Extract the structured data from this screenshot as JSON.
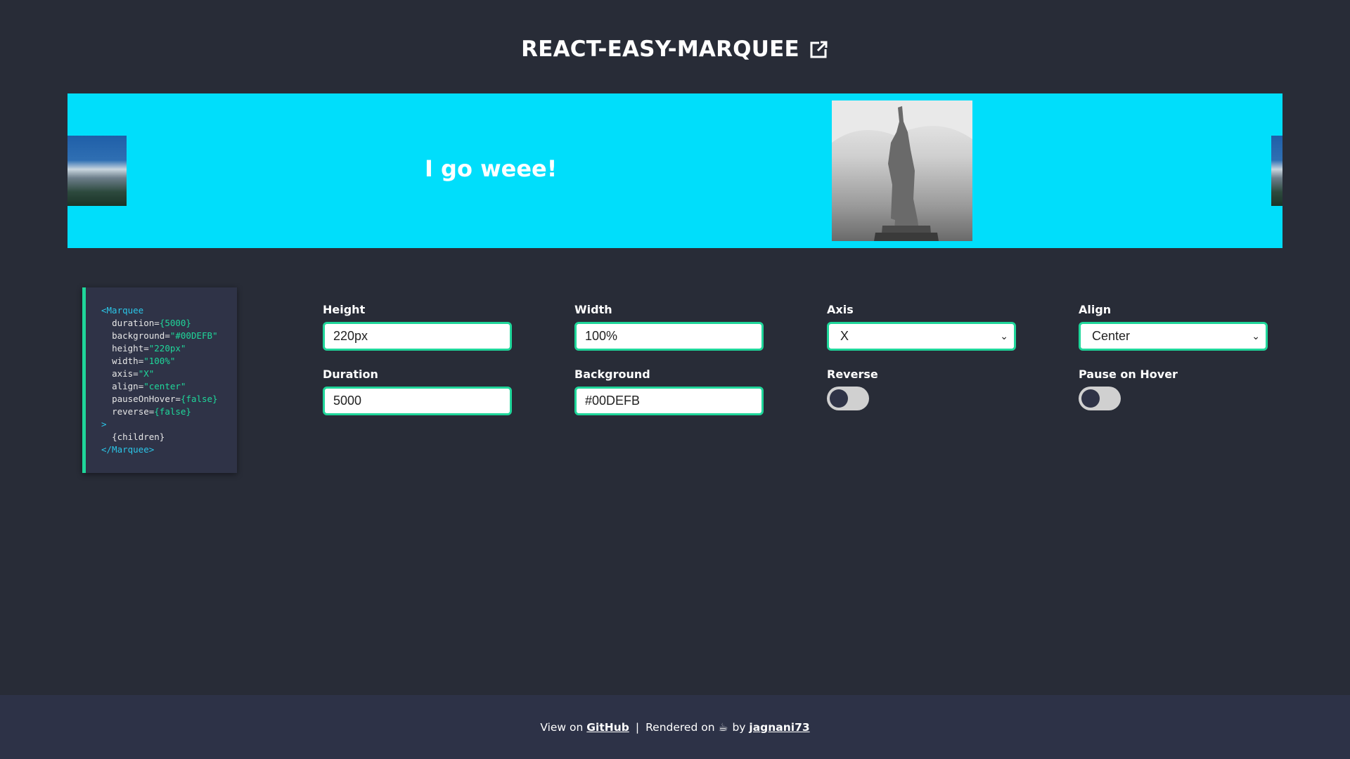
{
  "header": {
    "title": "REACT-EASY-MARQUEE",
    "link_icon": "external-link-icon"
  },
  "marquee": {
    "background": "#00DEFB",
    "text": "I go weee!",
    "items": [
      "mountain-image",
      "text",
      "statue-of-liberty-image",
      "mountain-image"
    ]
  },
  "code": {
    "open_tag": "<Marquee",
    "props": [
      {
        "name": "duration=",
        "value": "{5000}"
      },
      {
        "name": "background=",
        "value": "\"#00DEFB\""
      },
      {
        "name": "height=",
        "value": "\"220px\""
      },
      {
        "name": "width=",
        "value": "\"100%\""
      },
      {
        "name": "axis=",
        "value": "\"X\""
      },
      {
        "name": "align=",
        "value": "\"center\""
      },
      {
        "name": "pauseOnHover=",
        "value": "{false}"
      },
      {
        "name": "reverse=",
        "value": "{false}"
      }
    ],
    "close_bracket": ">",
    "children": "{children}",
    "close_tag": "</Marquee>"
  },
  "controls": {
    "height": {
      "label": "Height",
      "value": "220px"
    },
    "width": {
      "label": "Width",
      "value": "100%"
    },
    "axis": {
      "label": "Axis",
      "value": "X"
    },
    "align": {
      "label": "Align",
      "value": "Center"
    },
    "duration": {
      "label": "Duration",
      "value": "5000"
    },
    "background": {
      "label": "Background",
      "value": "#00DEFB"
    },
    "reverse": {
      "label": "Reverse",
      "on": false
    },
    "pause_on_hover": {
      "label": "Pause on Hover",
      "on": false
    }
  },
  "footer": {
    "view_on": "View on",
    "github": "GitHub",
    "sep": "|",
    "rendered_on": "Rendered on",
    "coffee": "☕",
    "by": "by",
    "author": "jagnani73"
  },
  "colors": {
    "accent": "#1fd69a",
    "page_bg": "#282c37",
    "footer_bg": "#2d3247"
  }
}
